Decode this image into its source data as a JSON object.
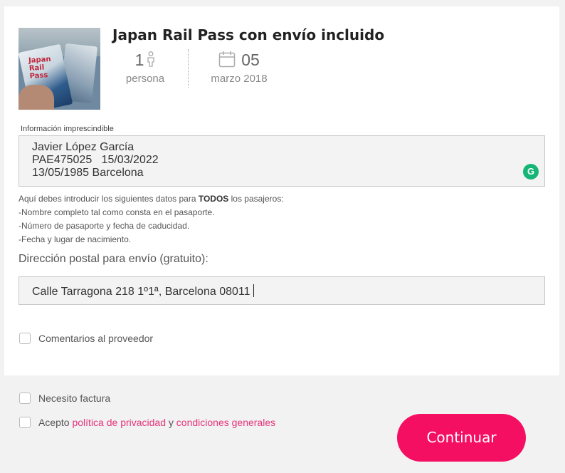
{
  "product": {
    "title": "Japan Rail Pass con envío incluido",
    "image_card_text": "Japan Rail Pass",
    "persons_value": "1",
    "persons_label": "persona",
    "date_day": "05",
    "date_month_year": "marzo 2018"
  },
  "info_field": {
    "label": "Información imprescindible",
    "lines": [
      "Javier López García",
      "PAE475025   15/03/2022",
      "13/05/1985 Barcelona"
    ],
    "grammarly_icon": "G"
  },
  "help_text": {
    "line1_prefix": "Aquí debes introducir los siguientes datos para ",
    "line1_bold": "TODOS",
    "line1_suffix": " los pasajeros:",
    "line2": "-Nombre completo tal como consta en el pasaporte.",
    "line3": "-Número de pasaporte y fecha de caducidad.",
    "line4": "-Fecha y lugar de nacimiento."
  },
  "address": {
    "label": "Dirección postal para envío (gratuito):",
    "value": "Calle Tarragona 218 1º1ª,  Barcelona 08011"
  },
  "comments_checkbox": {
    "label": "Comentarios al proveedor",
    "checked": false
  },
  "invoice_checkbox": {
    "label": "Necesito factura",
    "checked": false
  },
  "terms_checkbox": {
    "prefix": "Acepto ",
    "privacy_link": "política de privacidad",
    "middle": " y ",
    "conditions_link": "condiciones generales",
    "checked": false
  },
  "continue_button": {
    "label": "Continuar"
  },
  "colors": {
    "accent": "#f50f63",
    "link": "#e5337a",
    "grammarly": "#15b576"
  }
}
